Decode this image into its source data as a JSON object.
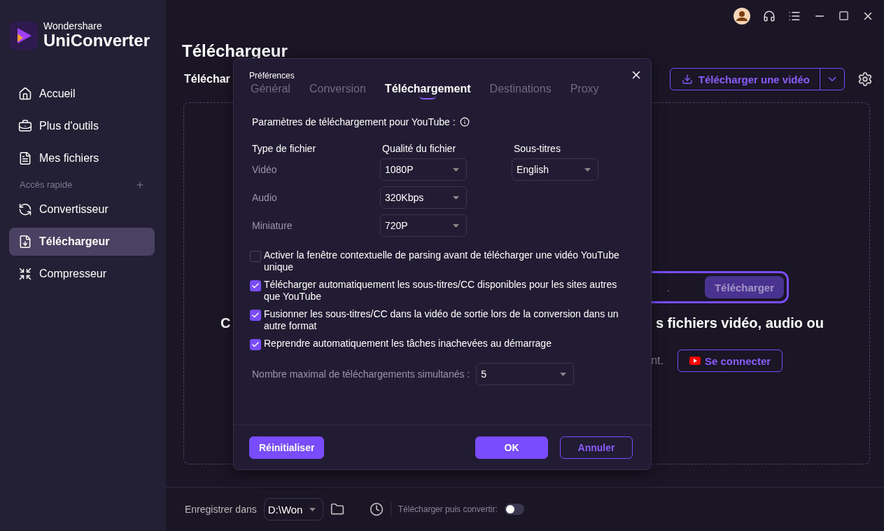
{
  "app": {
    "brand_small": "Wondershare",
    "brand_large": "UniConverter"
  },
  "sidebar": {
    "items": [
      {
        "label": "Accueil",
        "selected": false
      },
      {
        "label": "Plus d'outils",
        "selected": false
      },
      {
        "label": "Mes fichiers",
        "selected": false
      }
    ],
    "section": "Accès rapide",
    "quick_items": [
      {
        "label": "Convertisseur",
        "selected": false
      },
      {
        "label": "Téléchargeur",
        "selected": true
      },
      {
        "label": "Compresseur",
        "selected": false
      }
    ]
  },
  "page": {
    "title": "Téléchargeur",
    "subtitle": "Téléchar",
    "download_button": "Télécharger une vidéo",
    "url_placeholder": ".",
    "url_button": "Télécharger",
    "heading_left": "C",
    "heading_right": "s fichiers vidéo, audio ou",
    "note": "nt.",
    "login_button": "Se connecter"
  },
  "dialog": {
    "title": "Préférences",
    "tabs": [
      {
        "label": "Général",
        "selected": false
      },
      {
        "label": "Conversion",
        "selected": false
      },
      {
        "label": "Téléchargement",
        "selected": true
      },
      {
        "label": "Destinations",
        "selected": false
      },
      {
        "label": "Proxy",
        "selected": false
      }
    ],
    "section": "Paramètres de téléchargement pour YouTube :",
    "columns": [
      "Type de fichier",
      "Qualité du fichier",
      "Sous-titres"
    ],
    "rows": [
      {
        "type": "Vidéo",
        "quality": "1080P",
        "subtitles": "English"
      },
      {
        "type": "Audio",
        "quality": "320Kbps"
      },
      {
        "type": "Miniature",
        "quality": "720P"
      }
    ],
    "options": [
      {
        "label": "Activer la fenêtre contextuelle de parsing avant de télécharger une vidéo YouTube unique",
        "checked": false
      },
      {
        "label": "Télécharger automatiquement les sous-titres/CC disponibles pour les sites autres que YouTube",
        "checked": true
      },
      {
        "label": "Fusionner les sous-titres/CC dans la vidéo de sortie lors de la conversion dans un autre format",
        "checked": true
      },
      {
        "label": "Reprendre automatiquement les tâches inachevées au démarrage",
        "checked": true
      }
    ],
    "max_label": "Nombre maximal de téléchargements simultanés :",
    "max_value": "5",
    "buttons": {
      "reset": "Réinitialiser",
      "ok": "OK",
      "cancel": "Annuler"
    }
  },
  "footer": {
    "save_label": "Enregistrer dans",
    "path": "D:\\Won",
    "convert_label": "Télécharger puis convertir:",
    "convert_on": false
  }
}
